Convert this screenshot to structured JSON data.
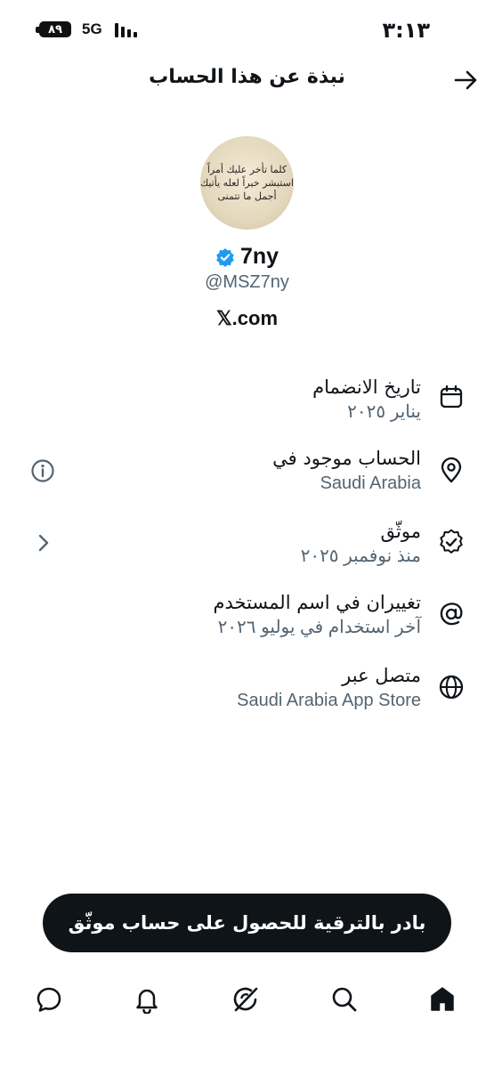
{
  "status_bar": {
    "time": "٣:١٣",
    "battery": "٨٩",
    "network": "5G"
  },
  "header": {
    "title": "نبذة عن هذا الحساب",
    "back_icon": "arrow-right-icon"
  },
  "profile": {
    "avatar_text": [
      "كلما تأخر عليك أمراً",
      "استبشر خيراً لعله يأتيك",
      "أجمل ما تتمنى"
    ],
    "name": "7ny",
    "handle": "@MSZ7ny",
    "site": "𝕏.com",
    "verified_color": "#1d9bf0"
  },
  "rows": [
    {
      "label": "تاريخ الانضمام",
      "value": "يناير ٢٠٢٥",
      "icon": "calendar-icon"
    },
    {
      "label": "الحساب موجود في",
      "value": "Saudi Arabia",
      "icon": "location-pin-icon",
      "side_icon": "info-icon"
    },
    {
      "label": "موثّق",
      "value": "منذ نوفمبر ٢٠٢٥",
      "icon": "verified-badge-icon",
      "side_icon": "chevron-right-icon"
    },
    {
      "label": "تغييران في اسم المستخدم",
      "value": "آخر استخدام في يوليو ٢٠٢٦",
      "icon": "at-sign-icon"
    },
    {
      "label": "متصل عبر",
      "value": "Saudi Arabia App Store",
      "icon": "globe-icon"
    }
  ],
  "upgrade_button": {
    "label": "بادر بالترقية للحصول على حساب موثّق"
  },
  "bottom_nav": [
    "home-icon",
    "search-icon",
    "grok-icon",
    "notifications-icon",
    "messages-icon"
  ]
}
